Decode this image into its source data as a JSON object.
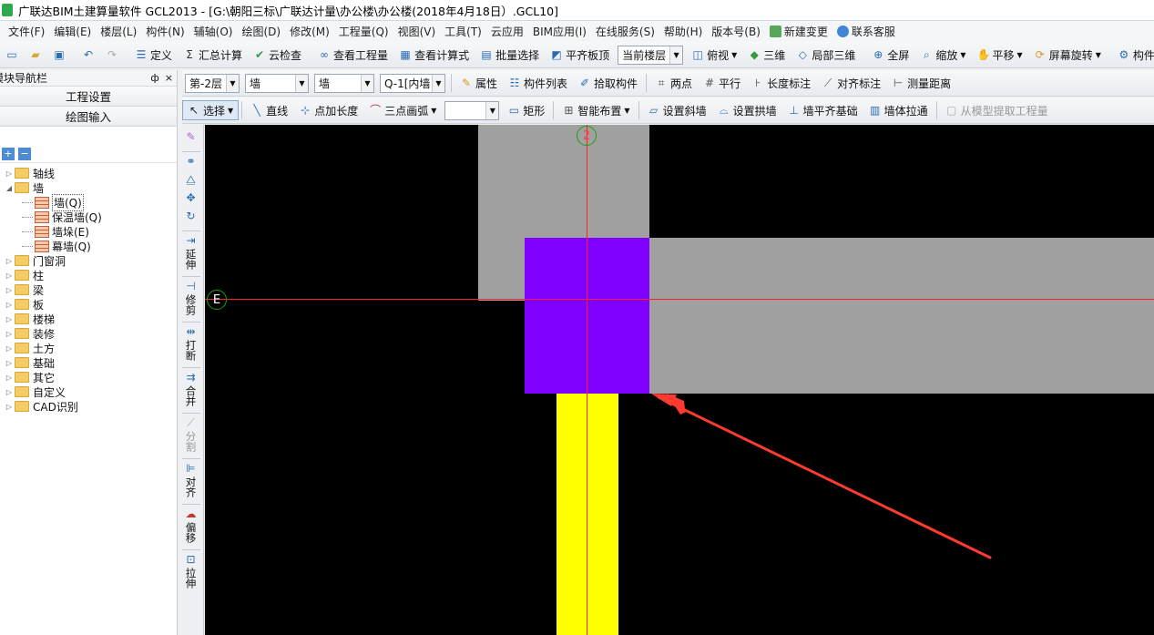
{
  "title": "广联达BIM土建算量软件 GCL2013 - [G:\\朝阳三标\\广联达计量\\办公楼\\办公楼(2018年4月18日）.GCL10]",
  "menu": [
    "文件(F)",
    "编辑(E)",
    "楼层(L)",
    "构件(N)",
    "辅轴(O)",
    "绘图(D)",
    "修改(M)",
    "工程量(Q)",
    "视图(V)",
    "工具(T)",
    "云应用",
    "BIM应用(I)",
    "在线服务(S)",
    "帮助(H)",
    "版本号(B)"
  ],
  "menu_extra": {
    "new_change": "新建变更",
    "support": "联系客服"
  },
  "toolbar1": {
    "define": "定义",
    "sum": "汇总计算",
    "cloud_check": "云检查",
    "view_qty": "查看工程量",
    "view_formula": "查看计算式",
    "batch_select": "批量选择",
    "flush_top": "平齐板顶",
    "floor_combo": "当前楼层",
    "top_view": "俯视",
    "three_d": "三维",
    "partial_3d": "局部三维",
    "fullscreen": "全屏",
    "zoom": "缩放",
    "pan": "平移",
    "rotate": "屏幕旋转",
    "component": "构件"
  },
  "toolbar2": {
    "floor": "第-2层",
    "type1": "墙",
    "type2": "墙",
    "component": "Q-1[内墙",
    "props": "属性",
    "comp_list": "构件列表",
    "pick": "拾取构件",
    "two_points": "两点",
    "parallel": "平行",
    "length_dim": "长度标注",
    "aligned_dim": "对齐标注",
    "measure": "测量距离"
  },
  "toolbar3": {
    "select": "选择",
    "line": "直线",
    "point_length": "点加长度",
    "three_arc": "三点画弧",
    "rect": "矩形",
    "smart": "智能布置",
    "slope": "设置斜墙",
    "arch": "设置拱墙",
    "align_base": "墙平齐基础",
    "stretch": "墙体拉通",
    "extract": "从模型提取工程量"
  },
  "panel": {
    "title": "模块导航栏",
    "pin": "ф",
    "close": "×",
    "project_settings": "工程设置",
    "drawing_input": "绘图输入",
    "tree": [
      {
        "label": "轴线",
        "expanded": false
      },
      {
        "label": "墙",
        "expanded": true,
        "children": [
          "墙(Q)",
          "保温墙(Q)",
          "墙垛(E)",
          "幕墙(Q)"
        ]
      },
      {
        "label": "门窗洞",
        "expanded": false
      },
      {
        "label": "柱",
        "expanded": false
      },
      {
        "label": "梁",
        "expanded": false
      },
      {
        "label": "板",
        "expanded": false
      },
      {
        "label": "楼梯",
        "expanded": false
      },
      {
        "label": "装修",
        "expanded": false
      },
      {
        "label": "土方",
        "expanded": false
      },
      {
        "label": "基础",
        "expanded": false
      },
      {
        "label": "其它",
        "expanded": false
      },
      {
        "label": "自定义",
        "expanded": false
      },
      {
        "label": "CAD识别",
        "expanded": false
      }
    ]
  },
  "vtools": {
    "extend": "延伸",
    "trim": "修剪",
    "break": "打断",
    "merge": "合并",
    "split": "分割",
    "align": "对齐",
    "offset": "偏移",
    "stretch": "拉伸"
  },
  "canvas": {
    "axis_top": "2",
    "axis_left": "E",
    "colors": {
      "wall": "#a0a0a0",
      "column": "#8000ff",
      "beam": "#ffff00",
      "axis": "#ff2020",
      "arrow": "#ff3b30"
    }
  }
}
